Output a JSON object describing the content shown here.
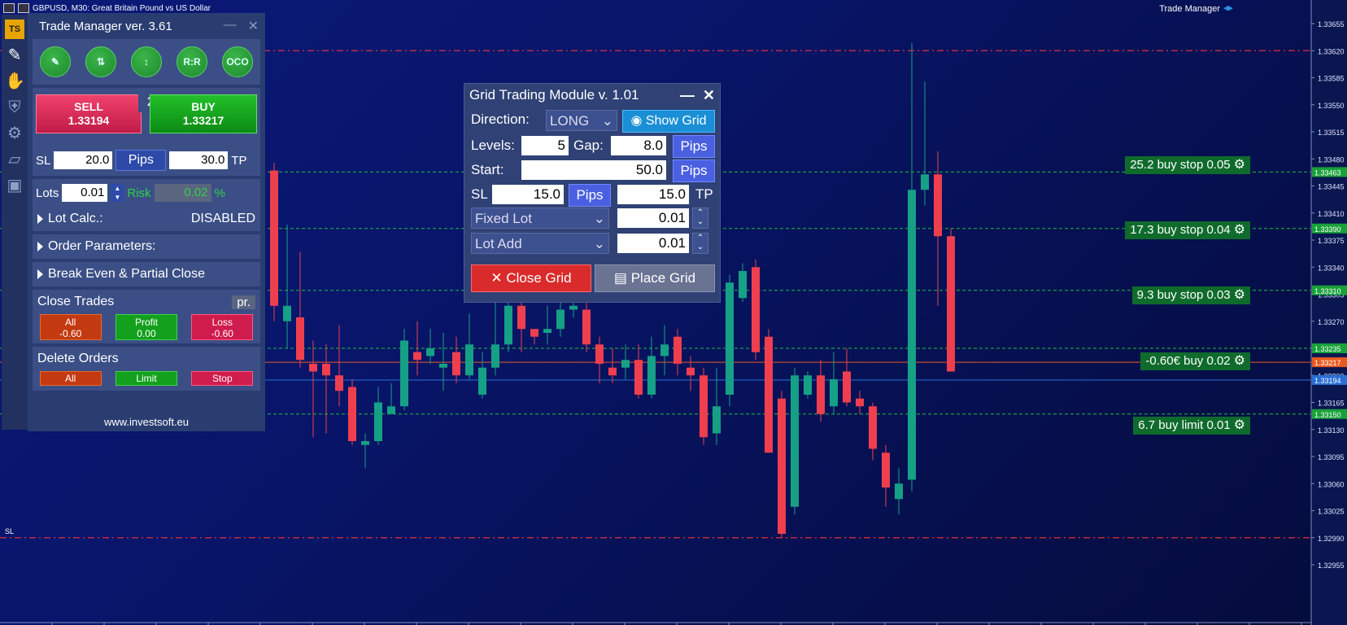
{
  "window": {
    "title": "GBPUSD, M30:  Great Britain Pound vs US Dollar",
    "brand": "Trade Manager"
  },
  "colors": {
    "bg_top": "#0a1a78",
    "bull": "#16a085",
    "bear": "#ef3f4f",
    "grid_line": "#1fbf3a",
    "sl_line": "#e0303a",
    "bid_line": "#2a6fd6",
    "ask_line": "#e85a20"
  },
  "price_axis": {
    "ticks": [
      "1.33655",
      "1.33620",
      "1.33585",
      "1.33550",
      "1.33515",
      "1.33480",
      "1.33445",
      "1.33410",
      "1.33375",
      "1.33340",
      "1.33305",
      "1.33270",
      "1.33235",
      "1.33200",
      "1.33165",
      "1.33130",
      "1.33095",
      "1.33060",
      "1.33025",
      "1.32990",
      "1.32955"
    ],
    "markers": [
      {
        "text": "1.33463",
        "color": "#19a13a"
      },
      {
        "text": "1.33390",
        "color": "#19a13a"
      },
      {
        "text": "1.33310",
        "color": "#19a13a"
      },
      {
        "text": "1.33235",
        "color": "#19a13a"
      },
      {
        "text": "1.33217",
        "color": "#e85a20"
      },
      {
        "text": "1.33194",
        "color": "#2a6fd6"
      },
      {
        "text": "1.33150",
        "color": "#19a13a"
      }
    ]
  },
  "sl_label": "SL",
  "orders": [
    {
      "text": "25.2 buy stop 0.05",
      "icon": "gear-icon"
    },
    {
      "text": "17.3 buy stop 0.04",
      "icon": "gear-icon"
    },
    {
      "text": "9.3 buy stop 0.03",
      "icon": "gear-icon"
    },
    {
      "text": "-0.60€ buy 0.02",
      "icon": "gear-icon"
    },
    {
      "text": "6.7 buy limit 0.01",
      "icon": "gear-icon"
    }
  ],
  "candles": [
    [
      1.33465,
      1.3329,
      1.33475,
      1.3327,
      0
    ],
    [
      1.3329,
      1.3327,
      1.33395,
      1.33235,
      1
    ],
    [
      1.33275,
      1.3322,
      1.3336,
      1.3321,
      0
    ],
    [
      1.33215,
      1.33205,
      1.33245,
      1.3312,
      0
    ],
    [
      1.33215,
      1.332,
      1.3324,
      1.33125,
      0
    ],
    [
      1.332,
      1.3318,
      1.33265,
      1.3316,
      0
    ],
    [
      1.33185,
      1.33115,
      1.33195,
      1.3311,
      0
    ],
    [
      1.33115,
      1.3311,
      1.33125,
      1.3308,
      1
    ],
    [
      1.33115,
      1.33165,
      1.33185,
      1.3311,
      1
    ],
    [
      1.3315,
      1.3316,
      1.3319,
      1.3315,
      1
    ],
    [
      1.3316,
      1.33245,
      1.3326,
      1.33155,
      1
    ],
    [
      1.3323,
      1.3322,
      1.3327,
      1.332,
      0
    ],
    [
      1.33225,
      1.33235,
      1.3326,
      1.33215,
      1
    ],
    [
      1.33215,
      1.3321,
      1.33255,
      1.3318,
      1
    ],
    [
      1.3323,
      1.332,
      1.3325,
      1.3319,
      0
    ],
    [
      1.332,
      1.3324,
      1.3328,
      1.33195,
      1
    ],
    [
      1.33175,
      1.3321,
      1.3323,
      1.3317,
      1
    ],
    [
      1.3321,
      1.3324,
      1.333,
      1.332,
      1
    ],
    [
      1.3324,
      1.3329,
      1.3331,
      1.3323,
      1
    ],
    [
      1.3329,
      1.3326,
      1.333,
      1.3323,
      0
    ],
    [
      1.3326,
      1.3325,
      1.3326,
      1.3324,
      0
    ],
    [
      1.33255,
      1.3326,
      1.3329,
      1.3324,
      1
    ],
    [
      1.3326,
      1.33285,
      1.3331,
      1.3325,
      1
    ],
    [
      1.33285,
      1.3329,
      1.3332,
      1.33275,
      1
    ],
    [
      1.33285,
      1.3324,
      1.33305,
      1.3323,
      0
    ],
    [
      1.3324,
      1.33215,
      1.3325,
      1.3319,
      0
    ],
    [
      1.3321,
      1.332,
      1.33235,
      1.3319,
      0
    ],
    [
      1.3322,
      1.3321,
      1.3324,
      1.33195,
      1
    ],
    [
      1.3322,
      1.33175,
      1.3324,
      1.3317,
      0
    ],
    [
      1.33175,
      1.33225,
      1.3325,
      1.3317,
      1
    ],
    [
      1.33225,
      1.3324,
      1.33265,
      1.332,
      1
    ],
    [
      1.3325,
      1.33215,
      1.3326,
      1.332,
      0
    ],
    [
      1.3321,
      1.332,
      1.33225,
      1.3318,
      0
    ],
    [
      1.332,
      1.3312,
      1.3321,
      1.3311,
      0
    ],
    [
      1.33125,
      1.3316,
      1.3321,
      1.3311,
      1
    ],
    [
      1.33175,
      1.3332,
      1.3333,
      1.3316,
      1
    ],
    [
      1.333,
      1.33335,
      1.33345,
      1.33295,
      1
    ],
    [
      1.3334,
      1.3323,
      1.3335,
      1.3322,
      0
    ],
    [
      1.3325,
      1.331,
      1.3326,
      1.331,
      0
    ],
    [
      1.3317,
      1.32995,
      1.3318,
      1.3299,
      0
    ],
    [
      1.332,
      1.3303,
      1.3321,
      1.3302,
      1
    ],
    [
      1.33175,
      1.332,
      1.33205,
      1.3317,
      1
    ],
    [
      1.332,
      1.3315,
      1.3322,
      1.3314,
      0
    ],
    [
      1.33195,
      1.3316,
      1.3323,
      1.3315,
      1
    ],
    [
      1.33205,
      1.33165,
      1.33235,
      1.3316,
      0
    ],
    [
      1.3317,
      1.3316,
      1.3318,
      1.3315,
      0
    ],
    [
      1.3316,
      1.33105,
      1.33165,
      1.3309,
      0
    ],
    [
      1.331,
      1.33055,
      1.3311,
      1.3303,
      0
    ],
    [
      1.3306,
      1.3304,
      1.3308,
      1.3302,
      1
    ],
    [
      1.33065,
      1.3344,
      1.3363,
      1.3305,
      1
    ],
    [
      1.3344,
      1.3346,
      1.3358,
      1.3342,
      1
    ],
    [
      1.3346,
      1.3338,
      1.3349,
      1.3329,
      0
    ],
    [
      1.3338,
      1.33205,
      1.3339,
      1.33205,
      0
    ]
  ],
  "trade_manager": {
    "title": "Trade Manager ver. 3.61",
    "tools": [
      {
        "label": "",
        "icon": "pencil-icon"
      },
      {
        "label": "",
        "icon": "reverse-icon"
      },
      {
        "label": "",
        "icon": "range-icon"
      },
      {
        "label": "R:R"
      },
      {
        "label": "OCO"
      }
    ],
    "sell": {
      "label": "SELL",
      "price": "1.33194"
    },
    "buy": {
      "label": "BUY",
      "price": "1.33217"
    },
    "spread": "2.3",
    "sl_label": "SL",
    "sl_value": "20.0",
    "pips": "Pips",
    "tp_value": "30.0",
    "tp_label": "TP",
    "lots_label": "Lots",
    "lots_value": "0.01",
    "risk_label": "Risk",
    "risk_value": "0.02",
    "risk_unit": "%",
    "lot_calc_label": "Lot Calc.:",
    "lot_calc_value": "DISABLED",
    "order_params": "Order Parameters:",
    "break_even": "Break Even & Partial Close",
    "close_trades": "Close Trades",
    "pr": "pr.",
    "close_all": {
      "label": "All",
      "value": "-0.60"
    },
    "close_profit": {
      "label": "Profit",
      "value": "0.00"
    },
    "close_loss": {
      "label": "Loss",
      "value": "-0.60"
    },
    "delete_orders": "Delete Orders",
    "del_all": "All",
    "del_limit": "Limit",
    "del_stop": "Stop",
    "footer": "www.investsoft.eu"
  },
  "grid_module": {
    "title": "Grid Trading Module v. 1.01",
    "direction_label": "Direction:",
    "direction_value": "LONG",
    "show_grid": "Show Grid",
    "levels_label": "Levels:",
    "levels_value": "5",
    "gap_label": "Gap:",
    "gap_value": "8.0",
    "pips": "Pips",
    "start_label": "Start:",
    "start_value": "50.0",
    "sl_label": "SL",
    "sl_value": "15.0",
    "tp_value": "15.0",
    "tp_label": "TP",
    "lot_mode": "Fixed Lot",
    "lot_value": "0.01",
    "lot_add_mode": "Lot Add",
    "lot_add_value": "0.01",
    "close_grid": "Close Grid",
    "place_grid": "Place Grid"
  }
}
